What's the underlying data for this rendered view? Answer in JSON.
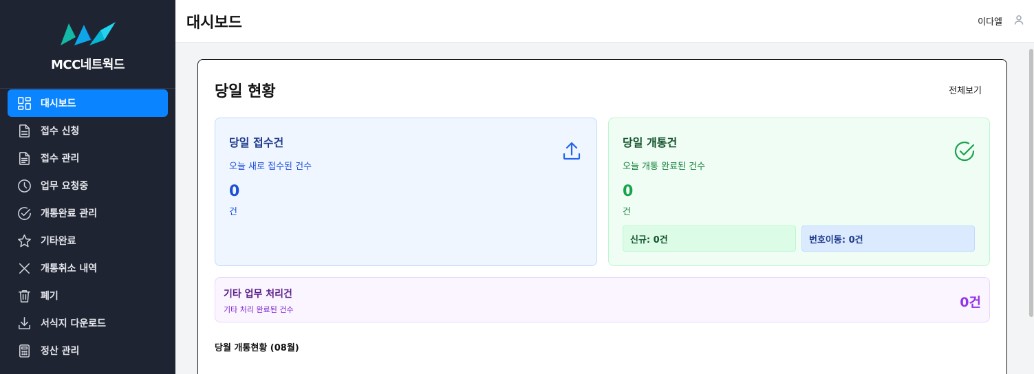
{
  "brand": {
    "name": "MCC네트웍드",
    "logo_colors": [
      "#0ea5a4",
      "#1e40af",
      "#22d3ee"
    ]
  },
  "sidebar": {
    "items": [
      {
        "label": "대시보드",
        "icon": "dashboard-icon",
        "active": true
      },
      {
        "label": "접수 신청",
        "icon": "document-icon"
      },
      {
        "label": "접수 관리",
        "icon": "document-list-icon"
      },
      {
        "label": "업무 요청중",
        "icon": "clock-icon"
      },
      {
        "label": "개통완료 관리",
        "icon": "check-circle-icon"
      },
      {
        "label": "기타완료",
        "icon": "star-icon"
      },
      {
        "label": "개통취소 내역",
        "icon": "x-icon"
      },
      {
        "label": "폐기",
        "icon": "trash-icon"
      },
      {
        "label": "서식지 다운로드",
        "icon": "download-icon"
      },
      {
        "label": "정산 관리",
        "icon": "calculator-icon"
      }
    ]
  },
  "header": {
    "title": "대시보드",
    "user_name": "이다엘"
  },
  "today": {
    "title": "당일 현황",
    "view_all": "전체보기",
    "received": {
      "title": "당일 접수건",
      "subtitle": "오늘 새로 접수된 건수",
      "value": "0",
      "unit": "건",
      "icon": "upload-icon"
    },
    "opened": {
      "title": "당일 개통건",
      "subtitle": "오늘 개통 완료된 건수",
      "value": "0",
      "unit": "건",
      "icon": "check-circle-icon",
      "new_label": "신규: 0건",
      "port_label": "번호이동: 0건"
    },
    "etc": {
      "title": "기타 업무 처리건",
      "subtitle": "기타 처리 완료된 건수",
      "value": "0건"
    }
  },
  "month": {
    "title": "당월 개통현황 (08월)"
  },
  "colors": {
    "sidebar_bg": "#1f2433",
    "accent": "#0a84ff",
    "blue": "#2563eb",
    "green": "#16a34a",
    "purple": "#9333ea"
  }
}
